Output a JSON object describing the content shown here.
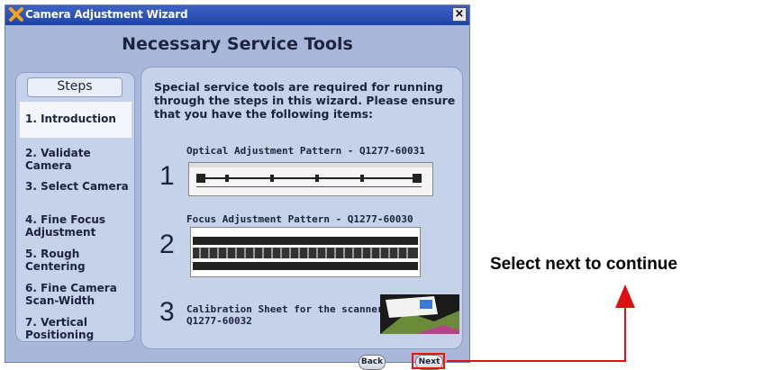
{
  "window": {
    "title": "Camera Adjustment Wizard",
    "close_label": "×"
  },
  "page_title": "Necessary Service Tools",
  "steps": {
    "header": "Steps",
    "items": [
      {
        "label": "1. Introduction",
        "active": true
      },
      {
        "label": "2. Validate Camera"
      },
      {
        "label": "3. Select Camera"
      },
      {
        "label": "4. Fine Focus Adjustment"
      },
      {
        "label": "5. Rough Centering"
      },
      {
        "label": "6. Fine Camera Scan-Width"
      },
      {
        "label": "7. Vertical Positioning"
      }
    ]
  },
  "content": {
    "intro": "Special service tools are required for running through the steps in this wizard. Please ensure that you have the following items:",
    "items": [
      {
        "number": "1",
        "label": "Optical Adjustment Pattern - Q1277-60031"
      },
      {
        "number": "2",
        "label": "Focus Adjustment Pattern - Q1277-60030"
      },
      {
        "number": "3",
        "label": "Calibration Sheet for the scanner",
        "label2": "Q1277-60032"
      }
    ]
  },
  "buttons": {
    "back": "Back",
    "next": "Next"
  },
  "annotation": {
    "text": "Select next to continue",
    "color": "#e01010"
  }
}
